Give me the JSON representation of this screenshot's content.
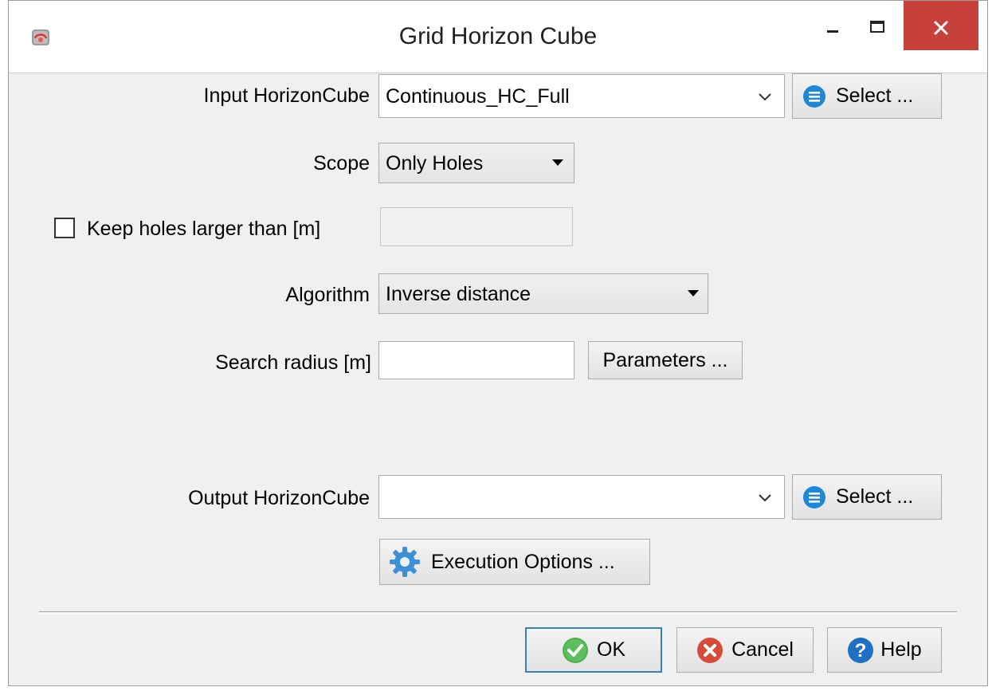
{
  "window": {
    "title": "Grid Horizon Cube"
  },
  "input": {
    "label": "Input HorizonCube",
    "value": "Continuous_HC_Full",
    "select_label": "Select ..."
  },
  "scope": {
    "label": "Scope",
    "value": "Only Holes"
  },
  "keep_holes": {
    "label": "Keep holes larger than [m]",
    "checked": false,
    "value": ""
  },
  "algorithm": {
    "label": "Algorithm",
    "value": "Inverse distance"
  },
  "search_radius": {
    "label": "Search radius [m]",
    "value": "",
    "parameters_label": "Parameters ..."
  },
  "output": {
    "label": "Output HorizonCube",
    "value": "",
    "select_label": "Select ..."
  },
  "execution": {
    "label": "Execution Options ..."
  },
  "footer": {
    "ok_label": "OK",
    "cancel_label": "Cancel",
    "help_label": "Help"
  },
  "colors": {
    "close_button": "#c7413a",
    "ok_focus_border": "#3c7fb1",
    "select_icon": "#1e88d6"
  }
}
